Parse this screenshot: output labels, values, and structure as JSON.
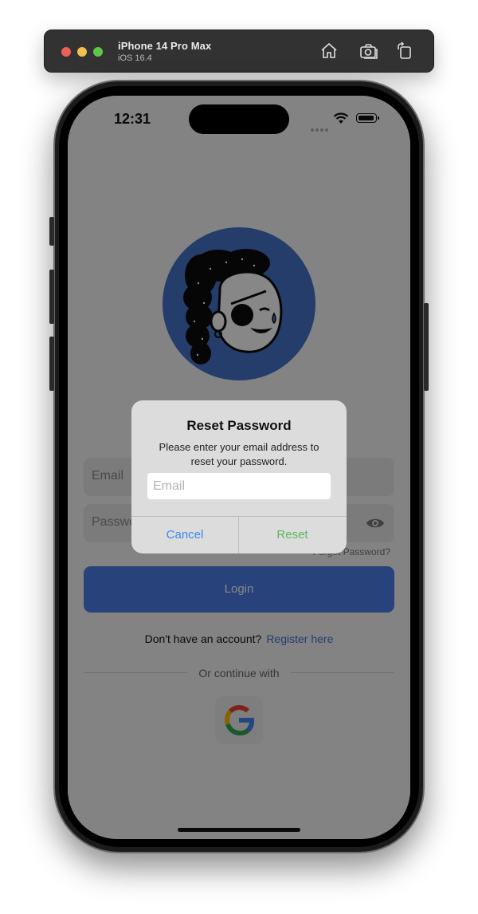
{
  "simulator": {
    "device_name": "iPhone 14 Pro Max",
    "os_version": "iOS 16.4",
    "toolbar_icons": [
      "home-icon",
      "screenshot-icon",
      "rotate-icon"
    ]
  },
  "status_bar": {
    "time": "12:31"
  },
  "login_screen": {
    "email_placeholder": "Email",
    "password_placeholder": "Password",
    "forgot_password": "Forgot Password?",
    "login_button": "Login",
    "no_account_text": "Don't have an account?",
    "register_link": "Register here",
    "divider_text": "Or continue with",
    "social_provider_icon": "google-icon"
  },
  "alert": {
    "title": "Reset Password",
    "message": "Please enter your email address to reset your password.",
    "input_placeholder": "Email",
    "cancel_label": "Cancel",
    "reset_label": "Reset"
  },
  "colors": {
    "accent_blue": "#3f88f2",
    "reset_green": "#5cb85c",
    "login_button": "#4d7de8",
    "avatar_background": "#4673c9"
  }
}
